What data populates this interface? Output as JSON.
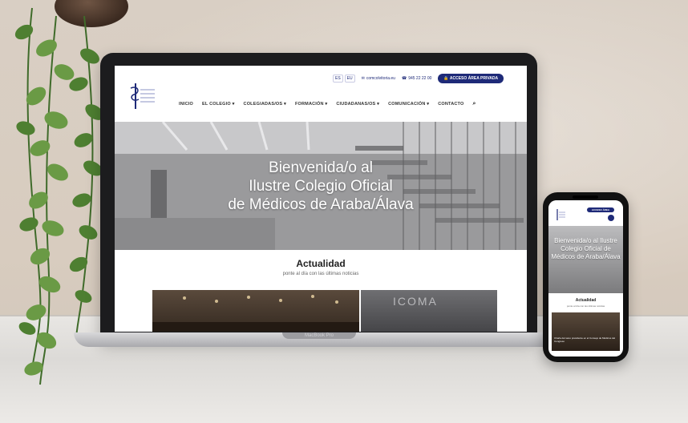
{
  "colors": {
    "brand": "#1e2a78",
    "wall": "#d9cfc4",
    "table": "#e8e6e3"
  },
  "site": {
    "languages": [
      "ES",
      "EU"
    ],
    "email": "comcolvitoria.eu",
    "phone": "945 22 22 00",
    "private_access": "ACCESO ÁREA PRIVADA",
    "nav": [
      "INICIO",
      "EL COLEGIO ▾",
      "COLEGIADAS/OS ▾",
      "FORMACIÓN ▾",
      "CIUDADANAS/OS ▾",
      "COMUNICACIÓN ▾",
      "CONTACTO"
    ],
    "search_icon": "⌕",
    "hero": {
      "line1": "Bienvenida/o al",
      "line2": "Ilustre Colegio Oficial",
      "line3": "de Médicos de Araba/Álava"
    },
    "news": {
      "title": "Actualidad",
      "subtitle": "ponte al día con las últimas noticias",
      "image2_text": "ICOMA"
    }
  },
  "laptop": {
    "model_label": "MacBook Pro"
  },
  "phone": {
    "private_access": "ACCESO ÁREA PRIVADA",
    "hero": "Bienvenida/o al Ilustre Colegio Oficial de Médicos de Araba/Álava",
    "news_title": "Actualidad",
    "news_subtitle": "ponte al día con las últimas noticias",
    "news_caption": "Charla del sano presidente en el Consejo de Médicos del Congreso"
  },
  "icons": {
    "email": "envelope-icon",
    "phone": "phone-icon",
    "lock": "lock-icon",
    "search": "search-icon",
    "menu": "menu-icon"
  }
}
